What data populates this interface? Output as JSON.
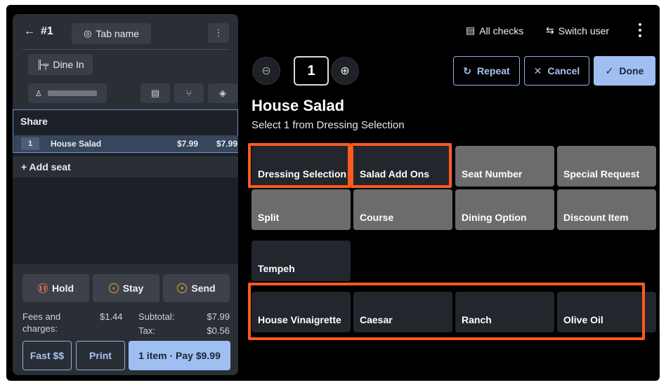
{
  "left_panel": {
    "check_number": "#1",
    "tab_name": "Tab name",
    "dine_option": "Dine In",
    "share_label": "Share",
    "item": {
      "qty": "1",
      "name": "House Salad",
      "unit_price": "$7.99",
      "total": "$7.99"
    },
    "add_seat": "+ Add seat",
    "actions": {
      "hold": "Hold",
      "stay": "Stay",
      "send": "Send"
    },
    "fees_label": "Fees and charges:",
    "fees_value": "$1.44",
    "subtotal_label": "Subtotal:",
    "subtotal_value": "$7.99",
    "tax_label": "Tax:",
    "tax_value": "$0.56",
    "fast_pay": "Fast $$",
    "print": "Print",
    "pay": "1 item · Pay $9.99"
  },
  "top_bar": {
    "all_checks": "All checks",
    "switch_user": "Switch user"
  },
  "modifier_header": {
    "quantity": "1",
    "repeat": "Repeat",
    "cancel": "Cancel",
    "done": "Done",
    "item_title": "House Salad",
    "instruction": "Select 1 from Dressing Selection"
  },
  "group_tiles": [
    "Dressing Selection",
    "Salad Add Ons",
    "Seat Number",
    "Special Request",
    "Split",
    "Course",
    "Dining Option",
    "Discount Item"
  ],
  "extra_tile": "Tempeh",
  "dressing_options": [
    "House Vinaigrette",
    "Caesar",
    "Ranch",
    "Olive Oil"
  ],
  "colors": {
    "accent": "#9fbff3",
    "highlight": "#ff5a1f",
    "grey_tile": "#6c6c6d",
    "dark_tile": "#23262c"
  }
}
